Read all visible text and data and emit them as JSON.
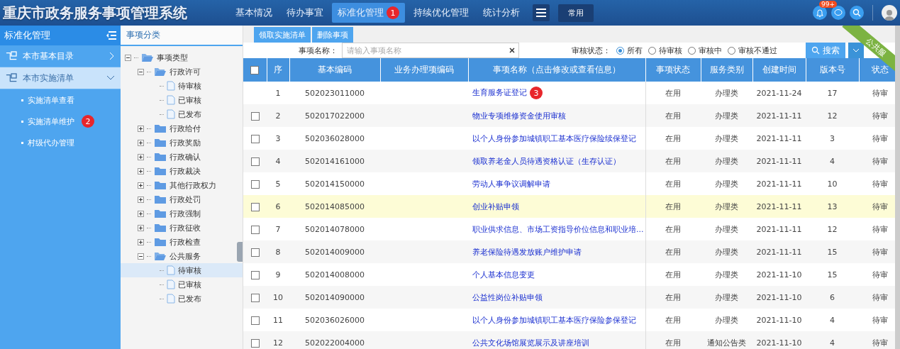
{
  "header": {
    "title": "重庆市政务服务事项管理系统",
    "nav": [
      {
        "label": "基本情况",
        "selected": false
      },
      {
        "label": "待办事宜",
        "selected": false
      },
      {
        "label": "标准化管理",
        "selected": true,
        "badge": "1"
      },
      {
        "label": "持续优化管理",
        "selected": false
      },
      {
        "label": "统计分析",
        "selected": false
      }
    ],
    "quick_button": "常用",
    "notification_count": "99+"
  },
  "sidebar": {
    "title": "标准化管理",
    "items": [
      {
        "label": "本市基本目录",
        "expanded": false
      },
      {
        "label": "本市实施清单",
        "expanded": true,
        "children": [
          {
            "label": "实施清单查看"
          },
          {
            "label": "实施清单维护",
            "badge": "2"
          },
          {
            "label": "村级代办管理"
          }
        ]
      }
    ]
  },
  "tree": {
    "title": "事项分类",
    "nodes": [
      {
        "label": "事项类型",
        "expanded": true,
        "children": [
          {
            "label": "行政许可",
            "expanded": true,
            "children": [
              {
                "label": "待审核",
                "selected": false
              },
              {
                "label": "已审核",
                "selected": false
              },
              {
                "label": "已发布",
                "selected": false
              }
            ]
          },
          {
            "label": "行政给付",
            "expanded": false
          },
          {
            "label": "行政奖励",
            "expanded": false
          },
          {
            "label": "行政确认",
            "expanded": false
          },
          {
            "label": "行政裁决",
            "expanded": false
          },
          {
            "label": "其他行政权力",
            "expanded": false
          },
          {
            "label": "行政处罚",
            "expanded": false
          },
          {
            "label": "行政强制",
            "expanded": false
          },
          {
            "label": "行政征收",
            "expanded": false
          },
          {
            "label": "行政检查",
            "expanded": false
          },
          {
            "label": "公共服务",
            "expanded": true,
            "children": [
              {
                "label": "待审核",
                "selected": true
              },
              {
                "label": "已审核",
                "selected": false
              },
              {
                "label": "已发布",
                "selected": false
              }
            ]
          }
        ]
      }
    ]
  },
  "toolbar": {
    "buttons": [
      "领取实施清单",
      "删除事项"
    ]
  },
  "filter": {
    "name_label": "事项名称：",
    "name_placeholder": "请输入事项名称",
    "status_label": "审核状态：",
    "status_options": [
      {
        "label": "所有",
        "selected": true
      },
      {
        "label": "待审核",
        "selected": false
      },
      {
        "label": "审核中",
        "selected": false
      },
      {
        "label": "审核不通过",
        "selected": false
      }
    ],
    "search_button": "搜索",
    "ribbon": "公共服"
  },
  "table": {
    "select_all_checked": false,
    "columns": [
      "序",
      "基本编码",
      "业务办理项编码",
      "事项名称（点击修改或查看信息）",
      "事项状态",
      "服务类别",
      "创建时间",
      "版本号",
      "状态"
    ],
    "rows": [
      {
        "highlighted": false,
        "index": "1",
        "code": "502023011000",
        "name": "生育服务证登记",
        "badge": "3",
        "state": "在用",
        "category": "办理类",
        "created": "2021-11-24",
        "version": "17",
        "status": "待审"
      },
      {
        "checked": false,
        "highlighted": false,
        "index": "2",
        "code": "502017022000",
        "name": "物业专项维修资金使用审核",
        "state": "在用",
        "category": "办理类",
        "created": "2021-11-11",
        "version": "12",
        "status": "待审"
      },
      {
        "checked": false,
        "highlighted": false,
        "index": "3",
        "code": "502036028000",
        "name": "以个人身份参加城镇职工基本医疗保险续保登记",
        "state": "在用",
        "category": "办理类",
        "created": "2021-11-11",
        "version": "3",
        "status": "待审"
      },
      {
        "checked": false,
        "highlighted": false,
        "index": "4",
        "code": "502014161000",
        "name": "领取养老金人员待遇资格认证（生存认证）",
        "state": "在用",
        "category": "办理类",
        "created": "2021-11-11",
        "version": "4",
        "status": "待审"
      },
      {
        "checked": false,
        "highlighted": false,
        "index": "5",
        "code": "502014150000",
        "name": "劳动人事争议调解申请",
        "state": "在用",
        "category": "办理类",
        "created": "2021-11-11",
        "version": "10",
        "status": "待审"
      },
      {
        "checked": false,
        "highlighted": true,
        "index": "6",
        "code": "502014085000",
        "name": "创业补贴申领",
        "state": "在用",
        "category": "办理类",
        "created": "2021-11-11",
        "version": "13",
        "status": "待审"
      },
      {
        "checked": false,
        "highlighted": false,
        "index": "7",
        "code": "502014078000",
        "name": "职业供求信息、市场工资指导价位信息和职业培...",
        "state": "在用",
        "category": "办理类",
        "created": "2021-11-11",
        "version": "12",
        "status": "待审"
      },
      {
        "checked": false,
        "highlighted": false,
        "index": "8",
        "code": "502014009000",
        "name": "养老保险待遇发放账户维护申请",
        "state": "在用",
        "category": "办理类",
        "created": "2021-11-11",
        "version": "15",
        "status": "待审"
      },
      {
        "checked": false,
        "highlighted": false,
        "index": "9",
        "code": "502014008000",
        "name": "个人基本信息变更",
        "state": "在用",
        "category": "办理类",
        "created": "2021-11-10",
        "version": "15",
        "status": "待审"
      },
      {
        "checked": false,
        "highlighted": false,
        "index": "10",
        "code": "502014090000",
        "name": "公益性岗位补贴申领",
        "state": "在用",
        "category": "办理类",
        "created": "2021-11-10",
        "version": "6",
        "status": "待审"
      },
      {
        "checked": false,
        "highlighted": false,
        "index": "11",
        "code": "502036026000",
        "name": "以个人身份参加城镇职工基本医疗保险参保登记",
        "state": "在用",
        "category": "办理类",
        "created": "2021-11-10",
        "version": "4",
        "status": "待审"
      },
      {
        "checked": false,
        "highlighted": false,
        "index": "12",
        "code": "502022004000",
        "name": "公共文化场馆展览展示及讲座培训",
        "state": "在用",
        "category": "通知公告类",
        "created": "2021-11-10",
        "version": "4",
        "status": "待审"
      }
    ]
  }
}
